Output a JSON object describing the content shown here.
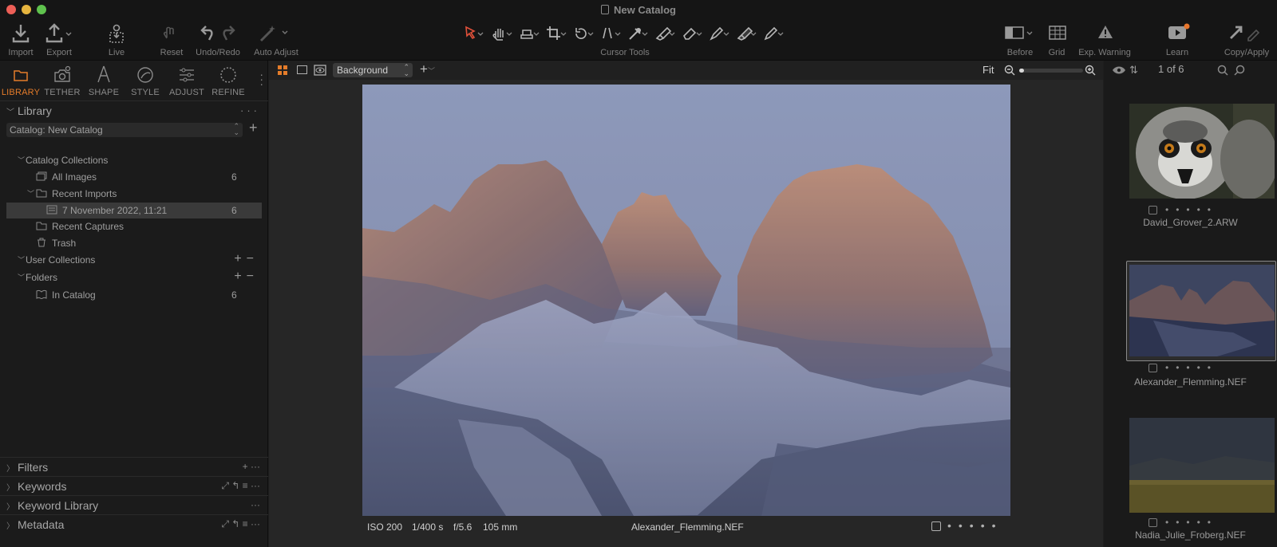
{
  "window": {
    "title": "New Catalog"
  },
  "toolbar": {
    "import_label": "Import",
    "export_label": "Export",
    "live_label": "Live",
    "reset_label": "Reset",
    "undo_redo_label": "Undo/Redo",
    "auto_adjust_label": "Auto Adjust",
    "cursor_tools_label": "Cursor Tools",
    "before_label": "Before",
    "grid_label": "Grid",
    "exp_warning_label": "Exp. Warning",
    "learn_label": "Learn",
    "copy_apply_label": "Copy/Apply",
    "learn_badge_color": "#e8762c"
  },
  "tool_tabs": [
    {
      "label": "LIBRARY",
      "active": true
    },
    {
      "label": "TETHER",
      "active": false
    },
    {
      "label": "SHAPE",
      "active": false
    },
    {
      "label": "STYLE",
      "active": false
    },
    {
      "label": "ADJUST",
      "active": false
    },
    {
      "label": "REFINE",
      "active": false
    }
  ],
  "library": {
    "title": "Library",
    "catalog_select": "Catalog: New Catalog",
    "catalog_collections_label": "Catalog Collections",
    "all_images": {
      "label": "All Images",
      "count": "6"
    },
    "recent_imports": {
      "label": "Recent Imports"
    },
    "import_entry": {
      "label": "7 November 2022, 11:21",
      "count": "6"
    },
    "recent_captures": {
      "label": "Recent Captures"
    },
    "trash": {
      "label": "Trash"
    },
    "user_collections_label": "User Collections",
    "folders_label": "Folders",
    "in_catalog": {
      "label": "In Catalog",
      "count": "6"
    }
  },
  "bottom_sections": {
    "filters": "Filters",
    "keywords": "Keywords",
    "keyword_library": "Keyword Library",
    "metadata": "Metadata"
  },
  "viewer": {
    "background_select": "Background",
    "fit_label": "Fit",
    "zoom_fraction": 0.08,
    "iso": "ISO 200",
    "shutter": "1/400 s",
    "aperture": "f/5.6",
    "focal_length": "105 mm",
    "filename": "Alexander_Flemming.NEF"
  },
  "browser": {
    "count_label": "1 of 6",
    "items": [
      {
        "name": "David_Grover_2.ARW",
        "selected": false
      },
      {
        "name": "Alexander_Flemming.NEF",
        "selected": true
      },
      {
        "name": "Nadia_Julie_Froberg.NEF",
        "selected": false
      }
    ]
  },
  "colors": {
    "accent": "#e47c2a",
    "cursor_tool_active": "#e0503a"
  }
}
